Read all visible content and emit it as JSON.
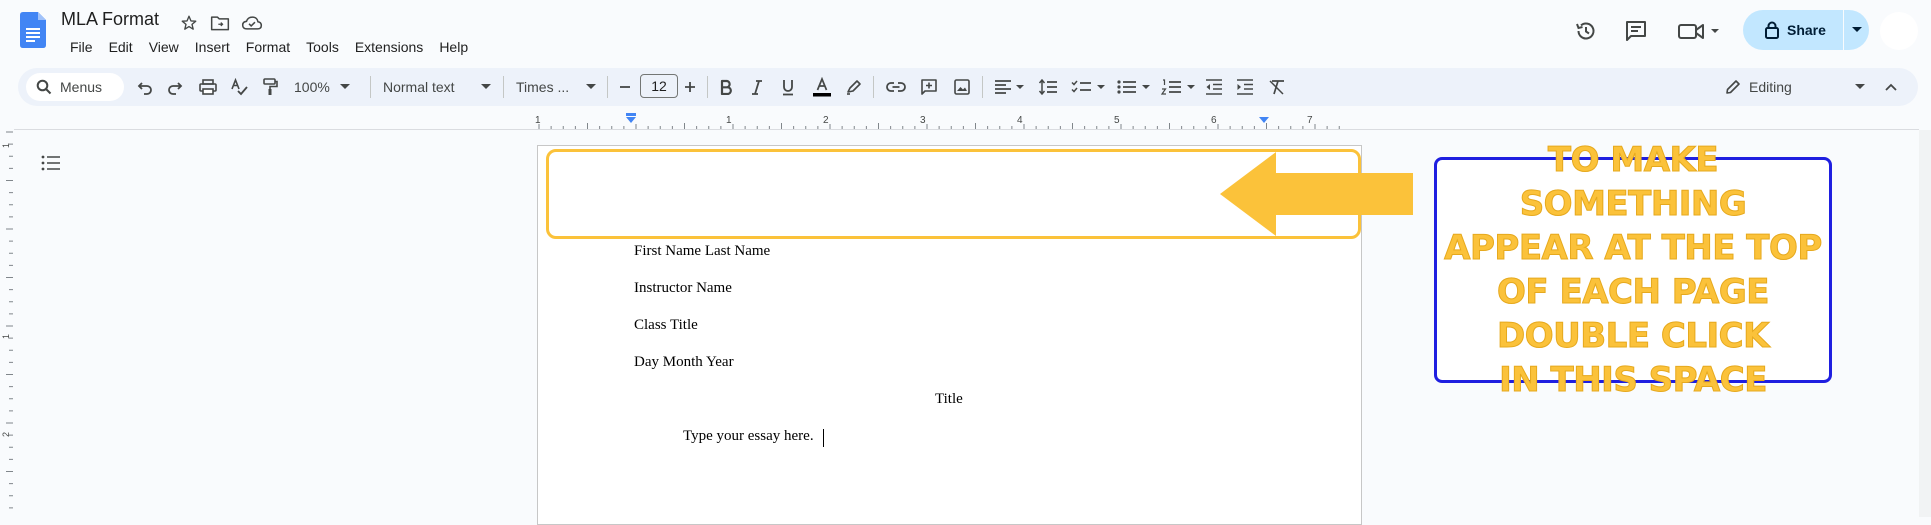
{
  "app": {
    "doc_title": "MLA Format",
    "menu": [
      "File",
      "Edit",
      "View",
      "Insert",
      "Format",
      "Tools",
      "Extensions",
      "Help"
    ],
    "share_label": "Share",
    "accent": "#c2e7ff",
    "doc_blue": "#4285f4"
  },
  "toolbar": {
    "search_label": "Menus",
    "zoom": "100%",
    "style": "Normal text",
    "font": "Times ...",
    "font_size": "12",
    "editing_mode": "Editing"
  },
  "ruler": {
    "numbers": [
      "1",
      "1",
      "2",
      "3",
      "4",
      "5",
      "6",
      "7"
    ],
    "left_numbers": [
      "1",
      "1",
      "2"
    ]
  },
  "document": {
    "lines": [
      "First Name Last Name",
      "Instructor Name",
      "Class Title",
      "Day Month Year"
    ],
    "title": "Title",
    "body": "Type your essay here."
  },
  "annotation": {
    "callout_lines": [
      "To make something",
      "appear at the top",
      "of each page",
      "double click",
      "in this space"
    ],
    "highlight_color": "#fbc23a",
    "box_color": "#1f1fe0"
  }
}
